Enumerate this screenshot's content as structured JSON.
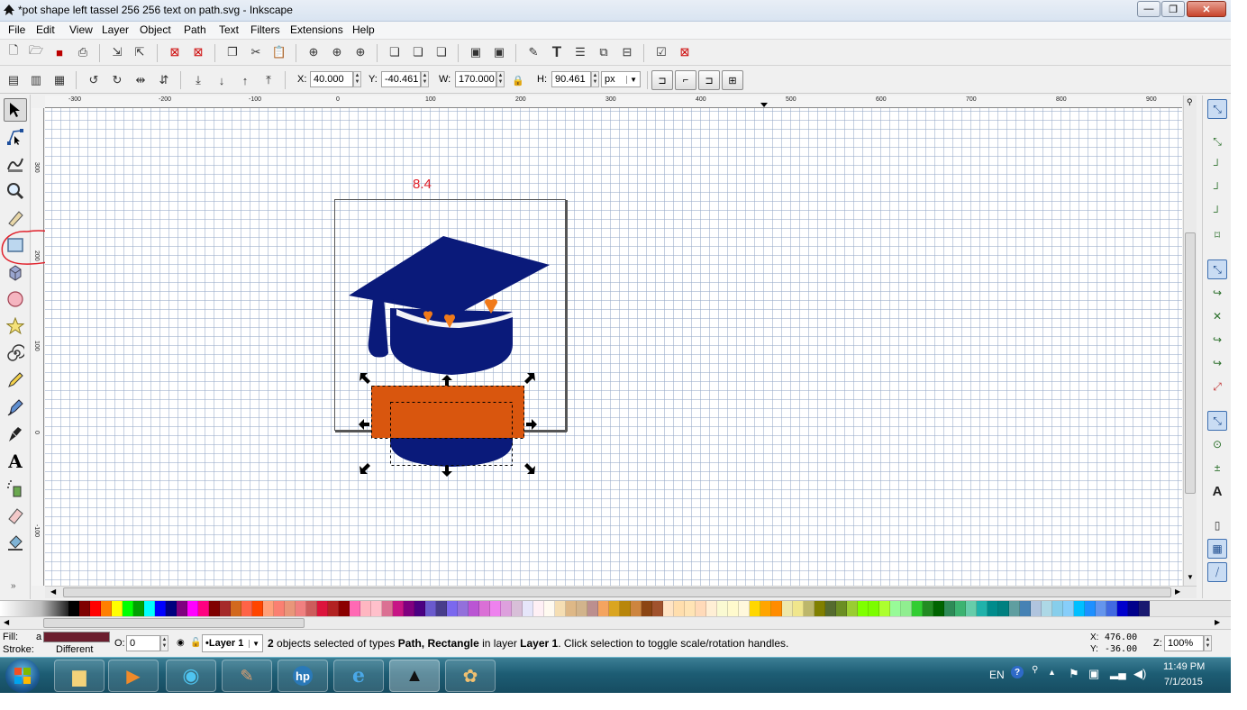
{
  "window": {
    "title": "*pot shape left tassel 256 256 text on path.svg - Inkscape"
  },
  "title_buttons": {
    "minimize": "—",
    "maximize": "❐",
    "close": "✕"
  },
  "menu": [
    "File",
    "Edit",
    "View",
    "Layer",
    "Object",
    "Path",
    "Text",
    "Filters",
    "Extensions",
    "Help"
  ],
  "controls": {
    "x_label": "X:",
    "x_value": "40.000",
    "y_label": "Y:",
    "y_value": "-40.461",
    "w_label": "W:",
    "w_value": "170.000",
    "h_label": "H:",
    "h_value": "90.461",
    "unit": "px"
  },
  "ruler": {
    "horizontal": [
      "-300",
      "-200",
      "-100",
      "0",
      "100",
      "200",
      "300",
      "400",
      "500",
      "600",
      "700",
      "800",
      "900"
    ],
    "vertical": [
      "300",
      "200",
      "100",
      "0",
      "-100"
    ]
  },
  "canvas": {
    "annotation_text": "8.4"
  },
  "colors": {
    "cap_navy": "#0a1a7a",
    "orange_fill": "#d9560e",
    "heart_orange": "#f07a1a",
    "annotation_red": "#e0202a",
    "page_border": "#555555"
  },
  "palette": [
    "#000000",
    "#7f0000",
    "#ff0000",
    "#ff7f00",
    "#ffff00",
    "#00ff00",
    "#00a000",
    "#00ffff",
    "#0000ff",
    "#00007f",
    "#7f007f",
    "#ff00ff",
    "#ff0080",
    "#800000",
    "#a52a2a",
    "#d2691e",
    "#ff6347",
    "#ff4500",
    "#ffa07a",
    "#fa8072",
    "#e9967a",
    "#f08080",
    "#cd5c5c",
    "#dc143c",
    "#b22222",
    "#8b0000",
    "#ff69b4",
    "#ffb6c1",
    "#ffc0cb",
    "#db7093",
    "#c71585",
    "#800080",
    "#4b0082",
    "#6a5acd",
    "#483d8b",
    "#7b68ee",
    "#9370db",
    "#ba55d3",
    "#da70d6",
    "#ee82ee",
    "#dda0dd",
    "#d8bfd8",
    "#e6e6fa",
    "#fff0f5",
    "#fffaf0",
    "#f5deb3",
    "#deb887",
    "#d2b48c",
    "#bc8f8f",
    "#f4a460",
    "#daa520",
    "#b8860b",
    "#cd853f",
    "#8b4513",
    "#a0522d",
    "#ffe4c4",
    "#ffdead",
    "#ffe4b5",
    "#ffdab9",
    "#ffefd5",
    "#fafad2",
    "#fffacd",
    "#fff8dc",
    "#ffd700",
    "#ffa500",
    "#ff8c00",
    "#eee8aa",
    "#f0e68c",
    "#bdb76b",
    "#808000",
    "#556b2f",
    "#6b8e23",
    "#9acd32",
    "#7fff00",
    "#7cfc00",
    "#adff2f",
    "#98fb98",
    "#90ee90",
    "#32cd32",
    "#228b22",
    "#006400",
    "#2e8b57",
    "#3cb371",
    "#66cdaa",
    "#20b2aa",
    "#008b8b",
    "#008080",
    "#5f9ea0",
    "#4682b4",
    "#b0c4de",
    "#add8e6",
    "#87ceeb",
    "#87cefa",
    "#00bfff",
    "#1e90ff",
    "#6495ed",
    "#4169e1",
    "#0000cd",
    "#00008b",
    "#191970"
  ],
  "status": {
    "fill_label": "Fill:",
    "fill_value": "a",
    "fill_color": "#6b1e2e",
    "stroke_label": "Stroke:",
    "stroke_value": "Different",
    "opacity_label": "O:",
    "opacity_value": "0",
    "layer": "•Layer 1",
    "message_bold_count": "2",
    "message_part1": " objects selected of types ",
    "message_types": "Path, Rectangle",
    "message_part2": " in layer ",
    "message_layer": "Layer 1",
    "message_part3": ". Click selection to toggle scale/rotation handles.",
    "cursor_x_label": "X:",
    "cursor_x": "476.00",
    "cursor_y_label": "Y:",
    "cursor_y": "-36.00",
    "zoom_label": "Z:",
    "zoom": "100%"
  },
  "taskbar": {
    "lang": "EN",
    "time": "11:49 PM",
    "date": "7/1/2015"
  }
}
